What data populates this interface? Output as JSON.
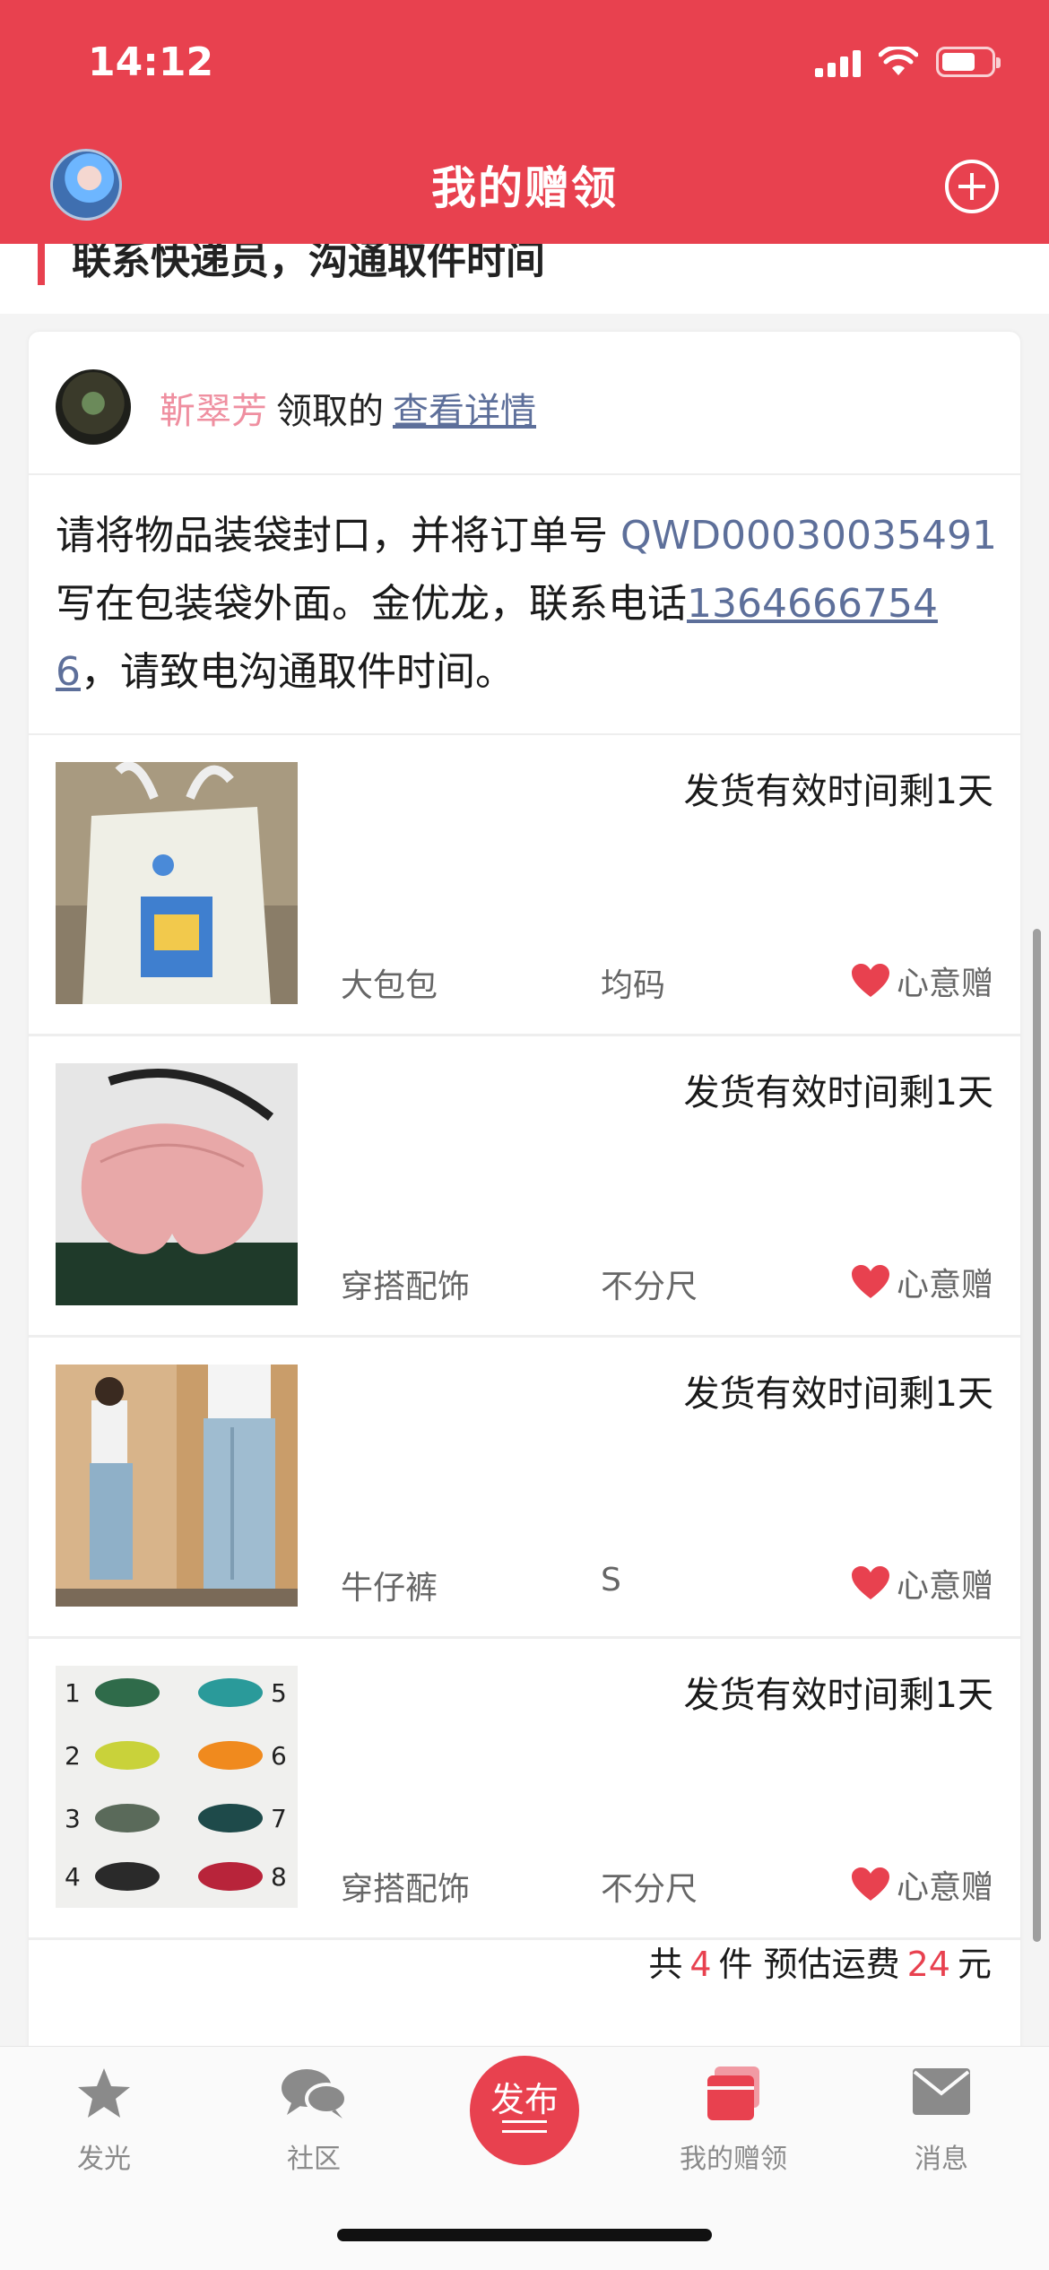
{
  "status_bar": {
    "time": "14:12"
  },
  "nav": {
    "title": "我的赠领"
  },
  "prev_card": {
    "text": "联系快递员，沟通取件时间"
  },
  "card": {
    "giver_name": "靳翠芳",
    "verb": "领取的",
    "detail_link": "查看详情",
    "instruction": {
      "part1": "请将物品装袋封口，并将订单号 ",
      "order_no": "QWD00030035491",
      "part2": " 写在包装袋外面。金优龙，联系电话",
      "phone": "13646667546",
      "part3": "，请致电沟通取件时间。"
    },
    "items": [
      {
        "deadline": "发货有效时间剩1天",
        "category": "大包包",
        "size": "均码",
        "gift": "心意赠"
      },
      {
        "deadline": "发货有效时间剩1天",
        "category": "穿搭配饰",
        "size": "不分尺",
        "gift": "心意赠"
      },
      {
        "deadline": "发货有效时间剩1天",
        "category": "牛仔裤",
        "size": "S",
        "gift": "心意赠"
      },
      {
        "deadline": "发货有效时间剩1天",
        "category": "穿搭配饰",
        "size": "不分尺",
        "gift": "心意赠"
      }
    ],
    "summary": {
      "prefix": "共",
      "count": "4",
      "count_unit": "件 预估运费",
      "fee": "24",
      "fee_unit": "元"
    }
  },
  "tabbar": {
    "tabs": [
      {
        "label": "发光",
        "icon": "star-icon"
      },
      {
        "label": "社区",
        "icon": "chat-bubbles-icon"
      },
      {
        "label": "发布",
        "icon": "publish-icon"
      },
      {
        "label": "我的赠领",
        "icon": "gift-stack-icon",
        "active": true
      },
      {
        "label": "消息",
        "icon": "mail-icon"
      }
    ]
  },
  "colors": {
    "brand": "#e8414f",
    "link": "#5d6f9a",
    "giver_name": "#ef8fa0"
  }
}
